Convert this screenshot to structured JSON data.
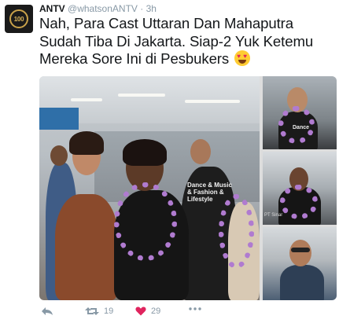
{
  "tweet": {
    "author_name": "ANTV",
    "author_handle": "@whatsonANTV",
    "separator": "·",
    "time": "3h",
    "avatar_text": "100",
    "text": "Nah, Para Cast Uttaran Dan Mahaputra Sudah Tiba Di Jakarta. Siap-2 Yuk Ketemu Mereka Sore Ini di Pesbukers",
    "emoji": "heart-eyes-emoji"
  },
  "media": {
    "main_photo_shirt_text": "Dance & Music & Fashion & Lifestyle",
    "thumb2_shirt_text": "PT Sinar",
    "thumb1_shirt_text": "Dance",
    "thumb3_shirt_text": ""
  },
  "actions": {
    "reply_icon": "reply-icon",
    "retweet_icon": "retweet-icon",
    "retweet_count": "19",
    "like_icon": "heart-icon",
    "like_count": "29",
    "more_icon": "more-icon"
  },
  "colors": {
    "text": "#14171a",
    "muted": "#8899a6",
    "like": "#e0245e"
  }
}
